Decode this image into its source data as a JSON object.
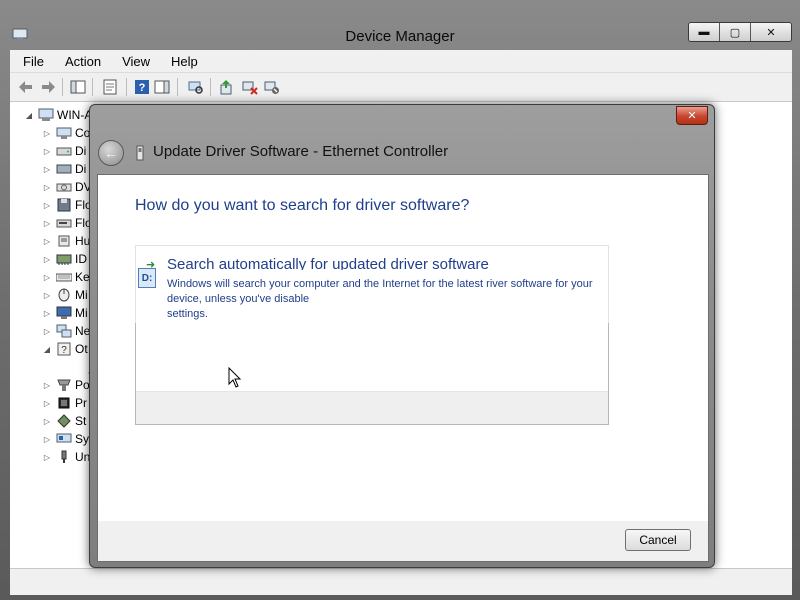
{
  "window": {
    "title": "Device Manager",
    "caption_buttons": [
      "minimize",
      "maximize",
      "close"
    ]
  },
  "menubar": [
    "File",
    "Action",
    "View",
    "Help"
  ],
  "toolbar_icons": [
    "back-arrow-icon",
    "forward-arrow-icon",
    "show-hide-tree-icon",
    "properties-icon",
    "help-icon",
    "action-pane-icon",
    "scan-hardware-icon",
    "update-driver-icon",
    "uninstall-icon",
    "disable-device-icon"
  ],
  "tree": {
    "root": "WIN-A",
    "items": [
      {
        "label": "Co",
        "icon": "computer-icon",
        "expanded": false
      },
      {
        "label": "Di",
        "icon": "disk-drive-icon",
        "expanded": false
      },
      {
        "label": "Di",
        "icon": "display-adapter-icon",
        "expanded": false
      },
      {
        "label": "DV",
        "icon": "dvd-drive-icon",
        "expanded": false
      },
      {
        "label": "Flo",
        "icon": "floppy-icon",
        "expanded": false
      },
      {
        "label": "Flo",
        "icon": "floppy-drive-icon",
        "expanded": false
      },
      {
        "label": "Hu",
        "icon": "hid-icon",
        "expanded": false
      },
      {
        "label": "ID",
        "icon": "ide-controller-icon",
        "expanded": false
      },
      {
        "label": "Ke",
        "icon": "keyboard-icon",
        "expanded": false
      },
      {
        "label": "Mi",
        "icon": "mouse-icon",
        "expanded": false
      },
      {
        "label": "Mi",
        "icon": "monitor-icon",
        "expanded": false
      },
      {
        "label": "Ne",
        "icon": "network-adapter-icon",
        "expanded": false
      },
      {
        "label": "Ot",
        "icon": "other-devices-icon",
        "expanded": true
      },
      {
        "label": "",
        "icon": "warning-device-icon",
        "expanded": null
      },
      {
        "label": "Po",
        "icon": "port-icon",
        "expanded": false
      },
      {
        "label": "Pr",
        "icon": "processor-icon",
        "expanded": false
      },
      {
        "label": "St",
        "icon": "storage-controller-icon",
        "expanded": false
      },
      {
        "label": "Sy",
        "icon": "system-devices-icon",
        "expanded": false
      },
      {
        "label": "Un",
        "icon": "usb-controller-icon",
        "expanded": false
      }
    ]
  },
  "dialog": {
    "title": "Update Driver Software - Ethernet Controller",
    "question": "How do you want to search for driver software?",
    "option_auto": {
      "title": "Search automatically for updated driver software",
      "description": "Windows will search your computer and the Internet for the latest   river software for your device, unless you've disable",
      "description_line3": "settings."
    },
    "cancel_label": "Cancel",
    "close_label": "✕"
  },
  "colors": {
    "accent_blue": "#1f3f8a",
    "close_red": "#c8452e"
  }
}
